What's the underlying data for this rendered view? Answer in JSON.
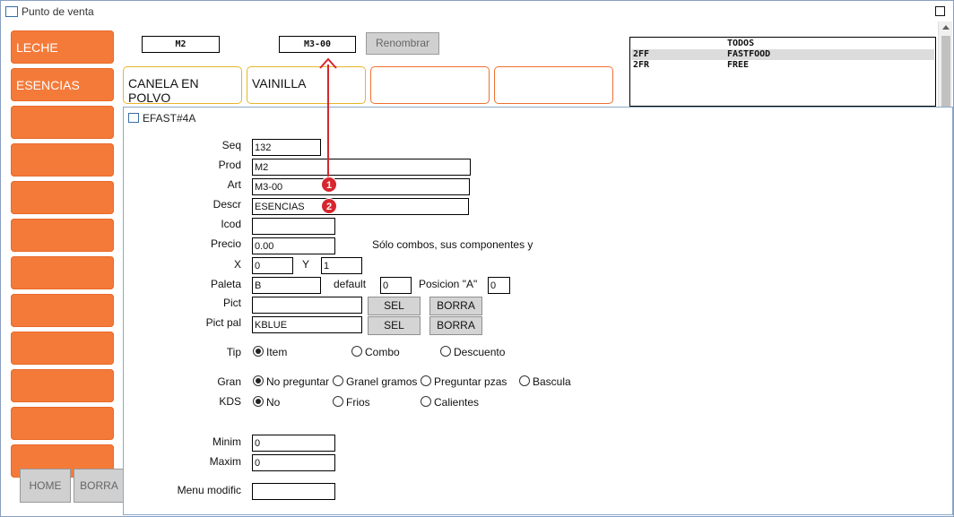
{
  "window": {
    "title": "Punto de venta"
  },
  "categories": [
    "LECHE",
    "ESENCIAS",
    "",
    "",
    "",
    "",
    "",
    "",
    "",
    "",
    "",
    ""
  ],
  "header": {
    "code1": "M2",
    "code2": "M3-00",
    "rename_label": "Renombrar"
  },
  "products": [
    "CANELA EN POLVO",
    "VAINILLA",
    "",
    ""
  ],
  "list": [
    {
      "code": "",
      "name": "TODOS",
      "selected": false
    },
    {
      "code": "2FF",
      "name": "FASTFOOD",
      "selected": true
    },
    {
      "code": "2FR",
      "name": "FREE",
      "selected": false
    }
  ],
  "bottom": {
    "home_label": "HOME",
    "borra_label": "BORRA"
  },
  "dialog": {
    "title": "EFAST#4A",
    "labels": {
      "seq": "Seq",
      "prod": "Prod",
      "art": "Art",
      "descr": "Descr",
      "icod": "Icod",
      "precio": "Precio",
      "x": "X",
      "y": "Y",
      "paleta": "Paleta",
      "default": "default",
      "posicion": "Posicion \"A\"",
      "pict": "Pict",
      "pict_pal": "Pict pal",
      "tip": "Tip",
      "gran": "Gran",
      "kds": "KDS",
      "minim": "Minim",
      "maxim": "Maxim",
      "menu_modific": "Menu modific"
    },
    "values": {
      "seq": "132",
      "prod": "M2",
      "art": "M3-00",
      "descr": "ESENCIAS",
      "icod": "",
      "precio": "0.00",
      "x": "0",
      "y": "1",
      "paleta": "B",
      "default": "0",
      "posicion": "0",
      "pict": "",
      "pict_pal": "KBLUE",
      "minim": "0",
      "maxim": "0",
      "menu_modific": ""
    },
    "note": "Sólo combos, sus componentes y",
    "sel_label": "SEL",
    "borra_label": "BORRA",
    "tip_options": [
      "Item",
      "Combo",
      "Descuento"
    ],
    "tip_selected": "Item",
    "gran_options": [
      "No preguntar",
      "Granel gramos",
      "Preguntar pzas",
      "Bascula"
    ],
    "gran_selected": "No preguntar",
    "kds_options": [
      "No",
      "Frios",
      "Calientes"
    ],
    "kds_selected": "No"
  },
  "annotations": [
    "1",
    "2"
  ],
  "colors": {
    "category_orange": "#f47a3a",
    "marker_red": "#d7262e",
    "card_yellow": "#e8b62a",
    "card_orange": "#f07030"
  }
}
